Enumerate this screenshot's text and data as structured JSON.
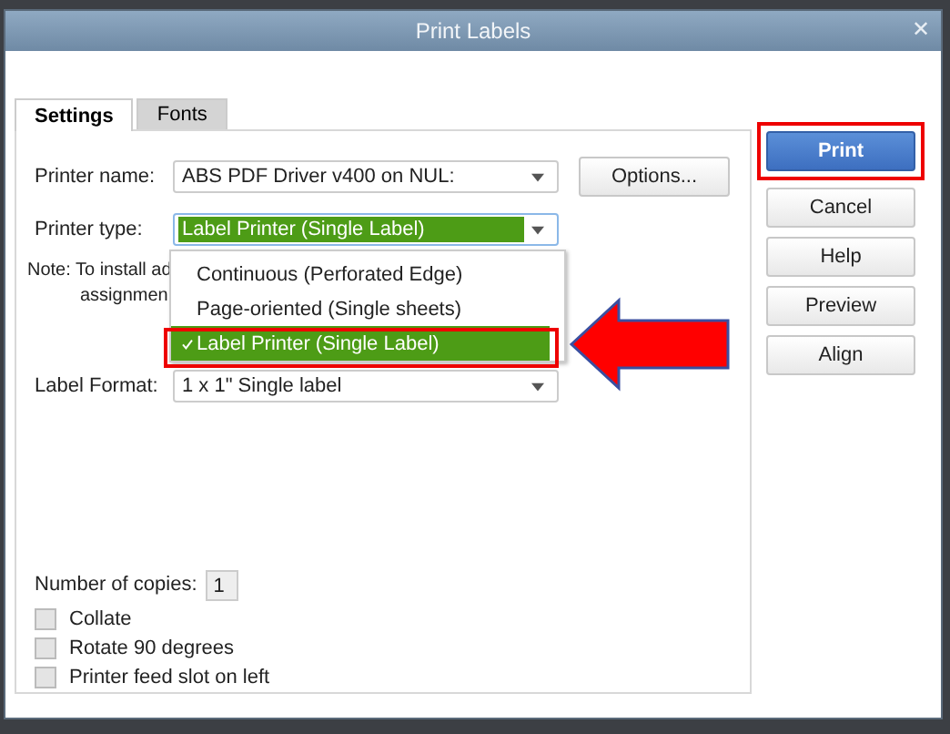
{
  "window": {
    "title": "Print Labels",
    "close": "✕"
  },
  "tabs": [
    {
      "label": "Settings",
      "selected": true
    },
    {
      "label": "Fonts",
      "selected": false
    }
  ],
  "printer_name": {
    "label": "Printer name:",
    "value": "ABS PDF Driver v400 on NUL:"
  },
  "options_button": "Options...",
  "printer_type": {
    "label": "Printer type:",
    "value": "Label Printer (Single Label)",
    "expanded": true
  },
  "printer_type_options": [
    {
      "label": "Continuous (Perforated Edge)",
      "selected": false
    },
    {
      "label": "Page-oriented (Single sheets)",
      "selected": false
    },
    {
      "label": "Label Printer (Single Label)",
      "selected": true
    }
  ],
  "note": [
    "Note: To install ad",
    "assignmen"
  ],
  "label_format": {
    "label": "Label Format:",
    "value": "1 x 1\" Single label"
  },
  "copies": {
    "label": "Number of copies:",
    "value": "1"
  },
  "checkboxes": [
    {
      "label": "Collate",
      "checked": false
    },
    {
      "label": "Rotate 90 degrees",
      "checked": false
    },
    {
      "label": "Printer feed slot on left",
      "checked": false
    }
  ],
  "buttons": [
    {
      "label": "Print",
      "kind": "primary"
    },
    {
      "label": "Cancel",
      "kind": "normal"
    },
    {
      "label": "Help",
      "kind": "normal"
    },
    {
      "label": "Preview",
      "kind": "normal"
    },
    {
      "label": "Align",
      "kind": "normal"
    }
  ]
}
